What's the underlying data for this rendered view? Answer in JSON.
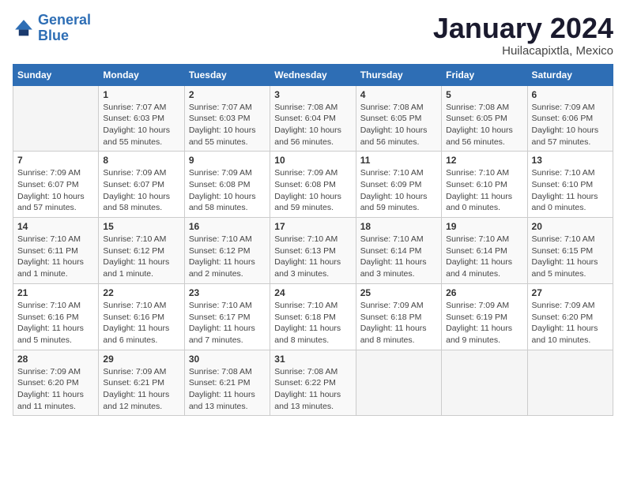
{
  "logo": {
    "line1": "General",
    "line2": "Blue"
  },
  "title": "January 2024",
  "subtitle": "Huilacapixtla, Mexico",
  "days_header": [
    "Sunday",
    "Monday",
    "Tuesday",
    "Wednesday",
    "Thursday",
    "Friday",
    "Saturday"
  ],
  "weeks": [
    [
      {
        "num": "",
        "info": ""
      },
      {
        "num": "1",
        "info": "Sunrise: 7:07 AM\nSunset: 6:03 PM\nDaylight: 10 hours\nand 55 minutes."
      },
      {
        "num": "2",
        "info": "Sunrise: 7:07 AM\nSunset: 6:03 PM\nDaylight: 10 hours\nand 55 minutes."
      },
      {
        "num": "3",
        "info": "Sunrise: 7:08 AM\nSunset: 6:04 PM\nDaylight: 10 hours\nand 56 minutes."
      },
      {
        "num": "4",
        "info": "Sunrise: 7:08 AM\nSunset: 6:05 PM\nDaylight: 10 hours\nand 56 minutes."
      },
      {
        "num": "5",
        "info": "Sunrise: 7:08 AM\nSunset: 6:05 PM\nDaylight: 10 hours\nand 56 minutes."
      },
      {
        "num": "6",
        "info": "Sunrise: 7:09 AM\nSunset: 6:06 PM\nDaylight: 10 hours\nand 57 minutes."
      }
    ],
    [
      {
        "num": "7",
        "info": "Sunrise: 7:09 AM\nSunset: 6:07 PM\nDaylight: 10 hours\nand 57 minutes."
      },
      {
        "num": "8",
        "info": "Sunrise: 7:09 AM\nSunset: 6:07 PM\nDaylight: 10 hours\nand 58 minutes."
      },
      {
        "num": "9",
        "info": "Sunrise: 7:09 AM\nSunset: 6:08 PM\nDaylight: 10 hours\nand 58 minutes."
      },
      {
        "num": "10",
        "info": "Sunrise: 7:09 AM\nSunset: 6:08 PM\nDaylight: 10 hours\nand 59 minutes."
      },
      {
        "num": "11",
        "info": "Sunrise: 7:10 AM\nSunset: 6:09 PM\nDaylight: 10 hours\nand 59 minutes."
      },
      {
        "num": "12",
        "info": "Sunrise: 7:10 AM\nSunset: 6:10 PM\nDaylight: 11 hours\nand 0 minutes."
      },
      {
        "num": "13",
        "info": "Sunrise: 7:10 AM\nSunset: 6:10 PM\nDaylight: 11 hours\nand 0 minutes."
      }
    ],
    [
      {
        "num": "14",
        "info": "Sunrise: 7:10 AM\nSunset: 6:11 PM\nDaylight: 11 hours\nand 1 minute."
      },
      {
        "num": "15",
        "info": "Sunrise: 7:10 AM\nSunset: 6:12 PM\nDaylight: 11 hours\nand 1 minute."
      },
      {
        "num": "16",
        "info": "Sunrise: 7:10 AM\nSunset: 6:12 PM\nDaylight: 11 hours\nand 2 minutes."
      },
      {
        "num": "17",
        "info": "Sunrise: 7:10 AM\nSunset: 6:13 PM\nDaylight: 11 hours\nand 3 minutes."
      },
      {
        "num": "18",
        "info": "Sunrise: 7:10 AM\nSunset: 6:14 PM\nDaylight: 11 hours\nand 3 minutes."
      },
      {
        "num": "19",
        "info": "Sunrise: 7:10 AM\nSunset: 6:14 PM\nDaylight: 11 hours\nand 4 minutes."
      },
      {
        "num": "20",
        "info": "Sunrise: 7:10 AM\nSunset: 6:15 PM\nDaylight: 11 hours\nand 5 minutes."
      }
    ],
    [
      {
        "num": "21",
        "info": "Sunrise: 7:10 AM\nSunset: 6:16 PM\nDaylight: 11 hours\nand 5 minutes."
      },
      {
        "num": "22",
        "info": "Sunrise: 7:10 AM\nSunset: 6:16 PM\nDaylight: 11 hours\nand 6 minutes."
      },
      {
        "num": "23",
        "info": "Sunrise: 7:10 AM\nSunset: 6:17 PM\nDaylight: 11 hours\nand 7 minutes."
      },
      {
        "num": "24",
        "info": "Sunrise: 7:10 AM\nSunset: 6:18 PM\nDaylight: 11 hours\nand 8 minutes."
      },
      {
        "num": "25",
        "info": "Sunrise: 7:09 AM\nSunset: 6:18 PM\nDaylight: 11 hours\nand 8 minutes."
      },
      {
        "num": "26",
        "info": "Sunrise: 7:09 AM\nSunset: 6:19 PM\nDaylight: 11 hours\nand 9 minutes."
      },
      {
        "num": "27",
        "info": "Sunrise: 7:09 AM\nSunset: 6:20 PM\nDaylight: 11 hours\nand 10 minutes."
      }
    ],
    [
      {
        "num": "28",
        "info": "Sunrise: 7:09 AM\nSunset: 6:20 PM\nDaylight: 11 hours\nand 11 minutes."
      },
      {
        "num": "29",
        "info": "Sunrise: 7:09 AM\nSunset: 6:21 PM\nDaylight: 11 hours\nand 12 minutes."
      },
      {
        "num": "30",
        "info": "Sunrise: 7:08 AM\nSunset: 6:21 PM\nDaylight: 11 hours\nand 13 minutes."
      },
      {
        "num": "31",
        "info": "Sunrise: 7:08 AM\nSunset: 6:22 PM\nDaylight: 11 hours\nand 13 minutes."
      },
      {
        "num": "",
        "info": ""
      },
      {
        "num": "",
        "info": ""
      },
      {
        "num": "",
        "info": ""
      }
    ]
  ]
}
